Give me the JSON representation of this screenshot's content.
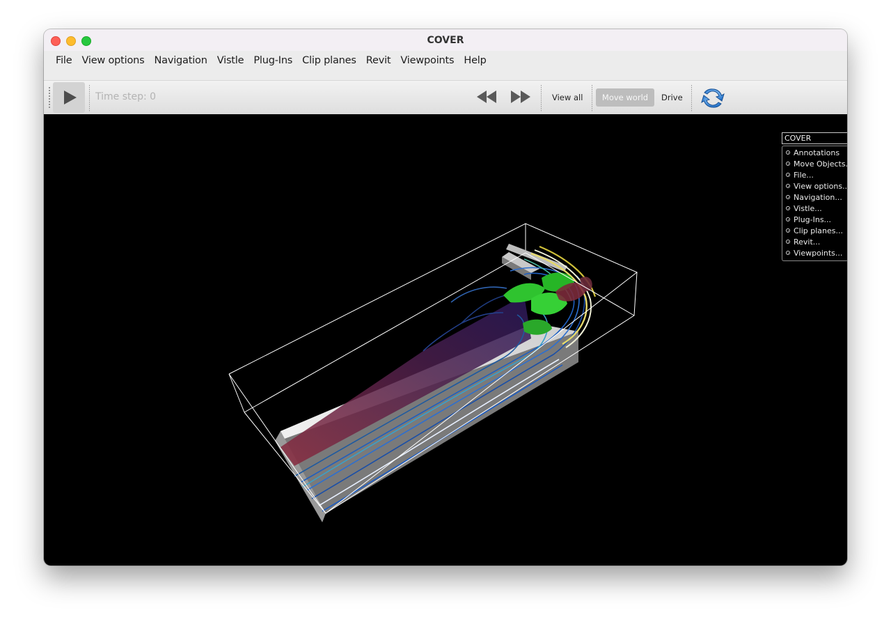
{
  "window": {
    "title": "COVER"
  },
  "menubar": {
    "items": [
      "File",
      "View options",
      "Navigation",
      "Vistle",
      "Plug-Ins",
      "Clip planes",
      "Revit",
      "Viewpoints",
      "Help"
    ]
  },
  "toolbar": {
    "play_icon": "play-icon",
    "time_step_label": "Time step: 0",
    "rewind_icon": "rewind-icon",
    "fast_forward_icon": "fast-forward-icon",
    "view_all_label": "View all",
    "move_world_label": "Move world",
    "drive_label": "Drive",
    "sync_icon": "sync-icon"
  },
  "cover_menu": {
    "title": "COVER",
    "items": [
      "Annotations",
      "Move Objects...",
      "File...",
      "View options...",
      "Navigation...",
      "Vistle...",
      "Plug-Ins...",
      "Clip planes...",
      "Revit...",
      "Viewpoints..."
    ]
  },
  "colors": {
    "viewport_background": "#000000",
    "bounding_box": "#ffffff",
    "geometry": "#d4d4d4",
    "isosurface": "#2ec12e",
    "cut_plane": "#6b2a44",
    "streamlines": "#1e4f9e"
  }
}
